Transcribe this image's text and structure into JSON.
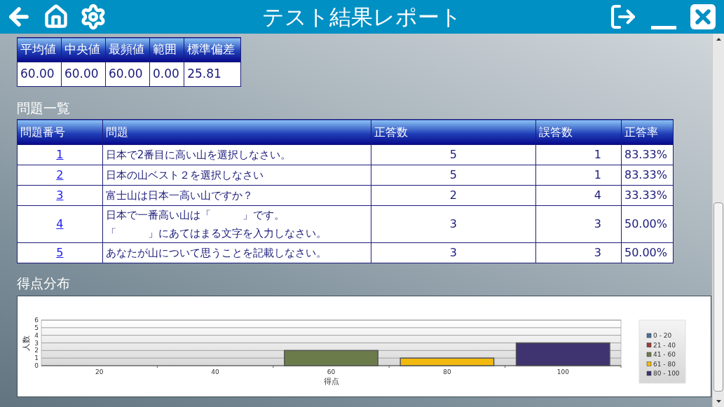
{
  "header": {
    "title": "テスト結果レポート"
  },
  "stats_table": {
    "columns": [
      "平均値",
      "中央値",
      "最頻値",
      "範囲",
      "標準偏差"
    ],
    "values": [
      "60.00",
      "60.00",
      "60.00",
      "0.00",
      "25.81"
    ]
  },
  "questions_section": {
    "heading": "問題一覧",
    "columns": [
      "問題番号",
      "問題",
      "正答数",
      "誤答数",
      "正答率"
    ],
    "rows": [
      {
        "number": "1",
        "question": [
          "日本で2番目に高い山を選択しなさい。"
        ],
        "correct": "5",
        "wrong": "1",
        "rate": "83.33%"
      },
      {
        "number": "2",
        "question": [
          "日本の山ベスト２を選択しなさい"
        ],
        "correct": "5",
        "wrong": "1",
        "rate": "83.33%"
      },
      {
        "number": "3",
        "question": [
          "富士山は日本一高い山ですか？"
        ],
        "correct": "2",
        "wrong": "4",
        "rate": "33.33%"
      },
      {
        "number": "4",
        "question": [
          "日本で一番高い山は「　　　」です。",
          "「　　　」にあてはまる文字を入力しなさい。"
        ],
        "correct": "3",
        "wrong": "3",
        "rate": "50.00%"
      },
      {
        "number": "5",
        "question": [
          "あなたが山について思うことを記載しなさい。"
        ],
        "correct": "3",
        "wrong": "3",
        "rate": "50.00%"
      }
    ]
  },
  "distribution_section": {
    "heading": "得点分布",
    "chart_data": {
      "type": "bar",
      "xlabel": "得点",
      "ylabel": "人数",
      "categories": [
        "20",
        "40",
        "60",
        "80",
        "100"
      ],
      "ylim": [
        0,
        6
      ],
      "yticks": [
        0,
        1,
        2,
        3,
        4,
        5,
        6
      ],
      "grid": true,
      "legend": true,
      "series": [
        {
          "name": "0 - 20",
          "color": "#4a6f9a",
          "values": [
            0,
            null,
            null,
            null,
            null
          ]
        },
        {
          "name": "21 - 40",
          "color": "#9a3a3a",
          "values": [
            null,
            0,
            null,
            null,
            null
          ]
        },
        {
          "name": "41 - 60",
          "color": "#6b7c4a",
          "values": [
            null,
            null,
            2,
            null,
            null
          ]
        },
        {
          "name": "61 - 80",
          "color": "#f2b90f",
          "values": [
            null,
            null,
            null,
            1,
            null
          ]
        },
        {
          "name": "80 - 100",
          "color": "#3f3370",
          "values": [
            null,
            null,
            null,
            null,
            3
          ]
        }
      ]
    }
  }
}
